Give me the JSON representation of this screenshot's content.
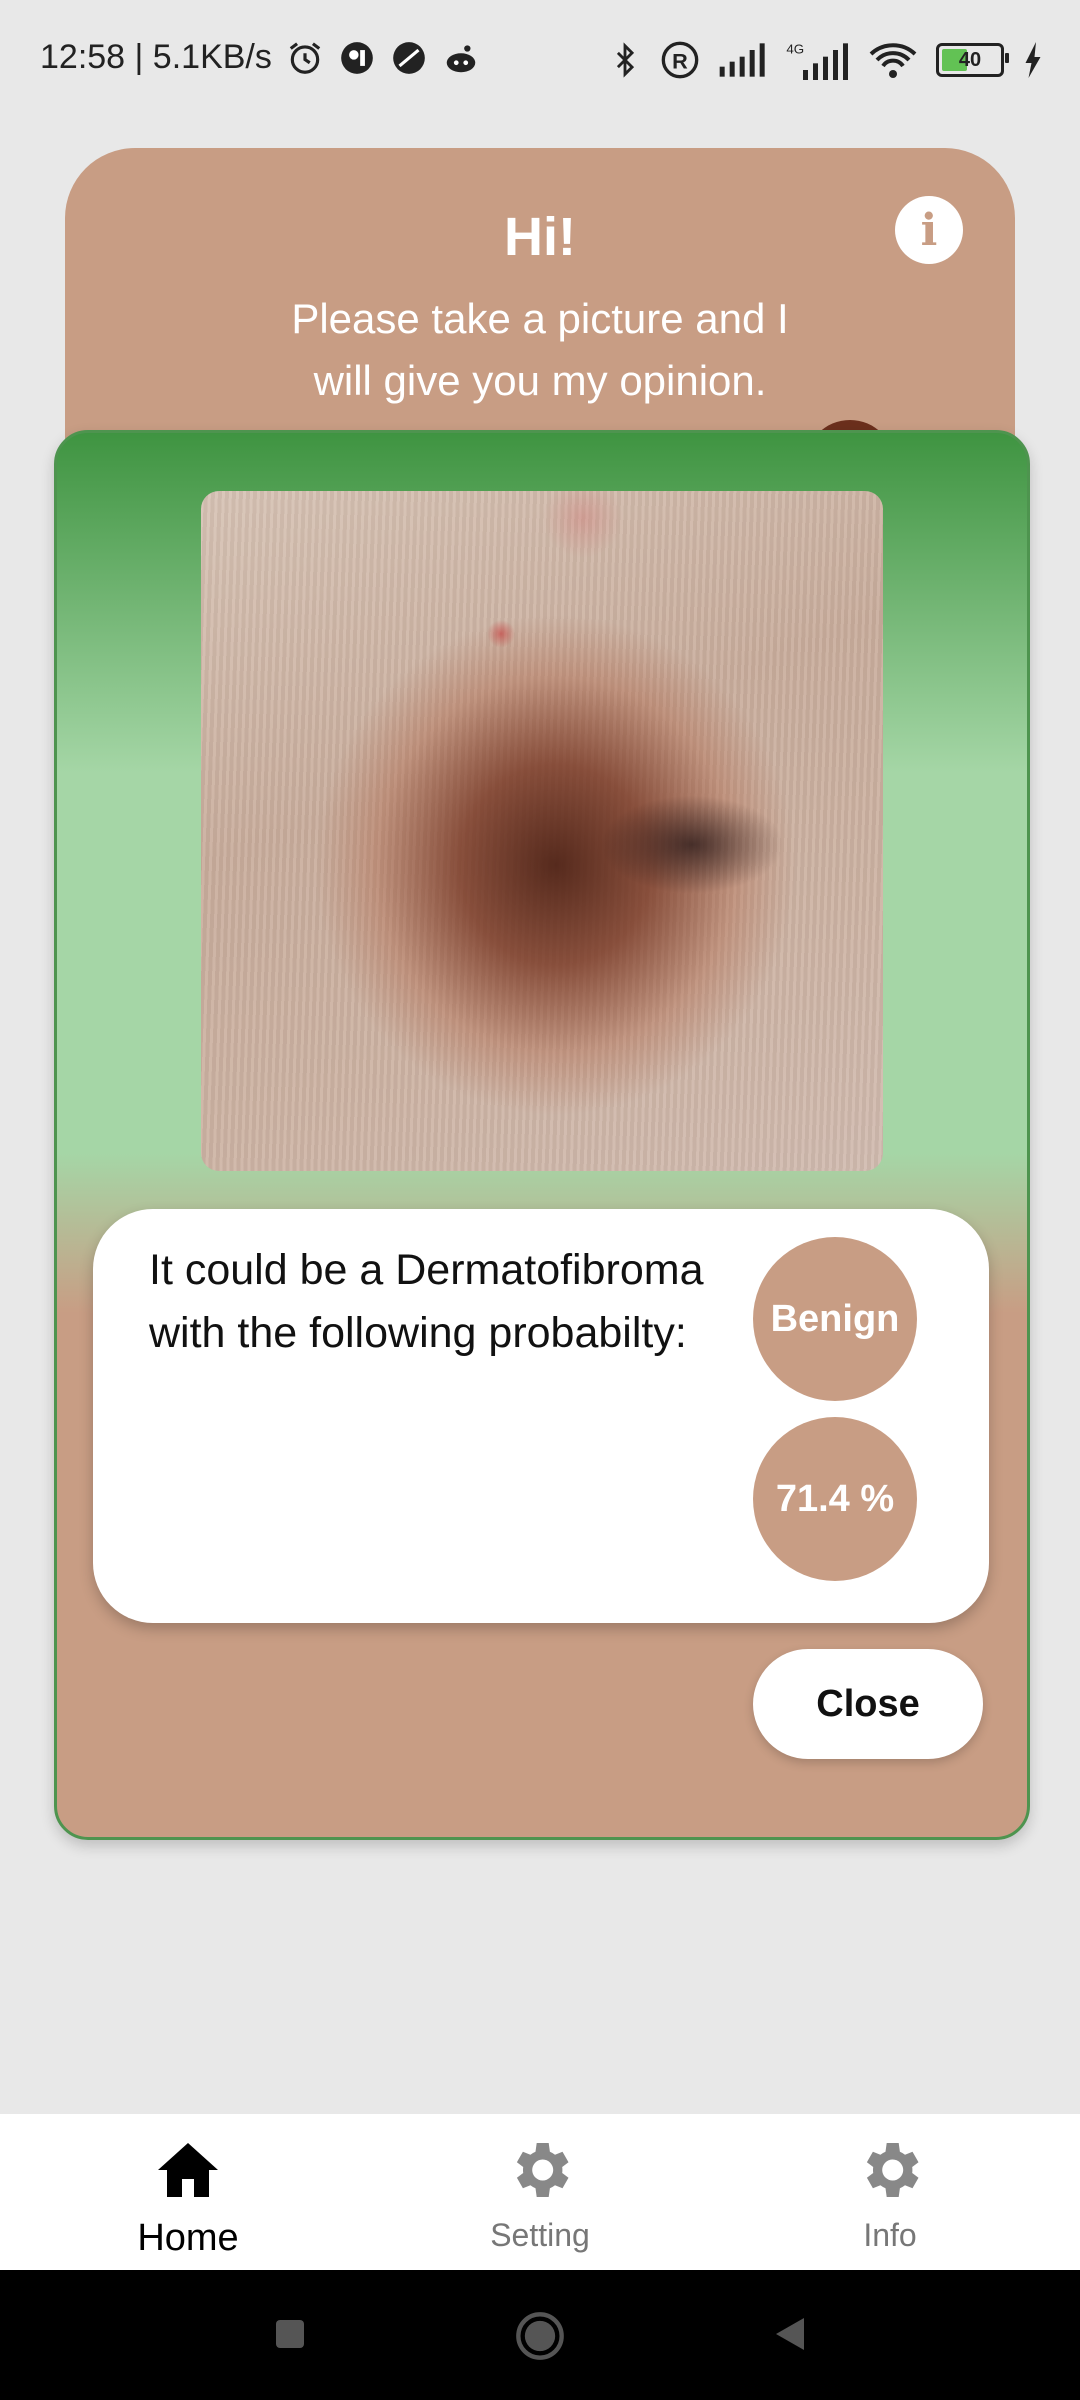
{
  "status_bar": {
    "time_speed": "12:58 | 5.1KB/s",
    "battery": "40",
    "network": "4G"
  },
  "header": {
    "title": "Hi!",
    "subtitle": "Please take a picture and I will give you my opinion."
  },
  "dialog": {
    "result_text": "It could be a Dermatofibroma with the following probabilty:",
    "classification": "Benign",
    "probability": "71.4 %",
    "close_label": "Close"
  },
  "bottom_nav": {
    "items": [
      {
        "label": "Home",
        "icon": "home-icon",
        "active": true
      },
      {
        "label": "Setting",
        "icon": "gear-icon",
        "active": false
      },
      {
        "label": "Info",
        "icon": "gear-icon",
        "active": false
      }
    ]
  },
  "colors": {
    "skin_accent": "#c89d84",
    "green_dark": "#3f9441",
    "green_light": "#a5d6a6"
  }
}
